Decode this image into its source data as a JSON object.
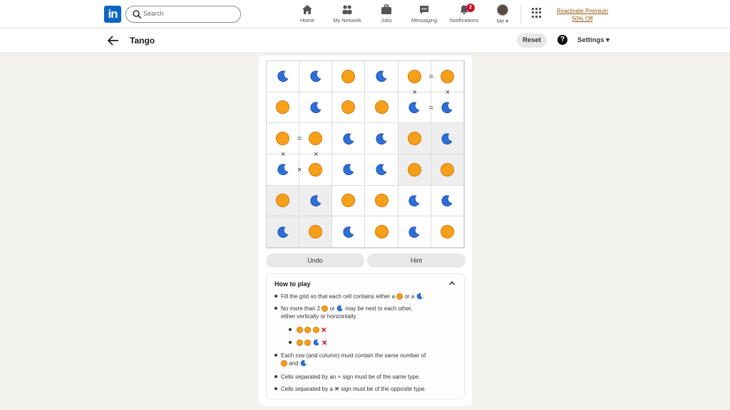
{
  "nav": {
    "logo": "in",
    "search_placeholder": "Search",
    "items": [
      {
        "label": "Home",
        "icon": "home-icon"
      },
      {
        "label": "My Network",
        "icon": "network-icon"
      },
      {
        "label": "Jobs",
        "icon": "briefcase-icon"
      },
      {
        "label": "Messaging",
        "icon": "message-icon"
      },
      {
        "label": "Notifications",
        "icon": "bell-icon",
        "badge": "2"
      },
      {
        "label": "Me ▾",
        "icon": "avatar"
      }
    ],
    "premium_line1": "Reactivate Premium",
    "premium_line2": "50% Off"
  },
  "header": {
    "title": "Tango",
    "reset_label": "Reset",
    "help": "?",
    "settings_label": "Settings ▾"
  },
  "board": {
    "cells": [
      [
        "moon",
        "moon",
        "sun",
        "moon",
        "sun",
        "sun"
      ],
      [
        "sun",
        "moon",
        "sun",
        "sun",
        "moon",
        "moon"
      ],
      [
        "sun",
        "sun",
        "moon",
        "moon",
        "sun",
        "moon"
      ],
      [
        "moon",
        "sun",
        "moon",
        "moon",
        "sun",
        "sun"
      ],
      [
        "sun",
        "moon",
        "sun",
        "sun",
        "moon",
        "moon"
      ],
      [
        "moon",
        "sun",
        "moon",
        "sun",
        "moon",
        "sun"
      ]
    ],
    "shaded": [
      [
        2,
        4
      ],
      [
        2,
        5
      ],
      [
        3,
        4
      ],
      [
        3,
        5
      ],
      [
        4,
        0
      ],
      [
        4,
        1
      ],
      [
        5,
        0
      ],
      [
        5,
        1
      ]
    ],
    "constraints": [
      {
        "row": 0,
        "col": 4,
        "dir": "right",
        "sym": "="
      },
      {
        "row": 0,
        "col": 4,
        "dir": "down",
        "sym": "×"
      },
      {
        "row": 0,
        "col": 5,
        "dir": "down",
        "sym": "×"
      },
      {
        "row": 1,
        "col": 4,
        "dir": "right",
        "sym": "="
      },
      {
        "row": 2,
        "col": 0,
        "dir": "right",
        "sym": "="
      },
      {
        "row": 2,
        "col": 0,
        "dir": "down",
        "sym": "×"
      },
      {
        "row": 2,
        "col": 1,
        "dir": "down",
        "sym": "×"
      },
      {
        "row": 3,
        "col": 0,
        "dir": "right",
        "sym": "×"
      }
    ]
  },
  "controls": {
    "undo_label": "Undo",
    "hint_label": "Hint"
  },
  "how_to_play": {
    "title": "How to play",
    "rule1_a": "Fill the grid so that each cell contains either a",
    "rule1_b": "or a",
    "rule1_c": ".",
    "rule2_a": "No more than 2",
    "rule2_b": "or",
    "rule2_c": "may be next to each other,",
    "rule2_d": "either vertically or horizontally.",
    "rule2_x": "✕",
    "rule3_a": "Each row (and column) must contain the same number of",
    "rule3_b": "and",
    "rule3_c": ".",
    "rule4": "Cells separated by an = sign must be of the same type.",
    "rule5_a": "Cells separated by a",
    "rule5_x": "✕",
    "rule5_b": "sign must be of the opposite type."
  }
}
